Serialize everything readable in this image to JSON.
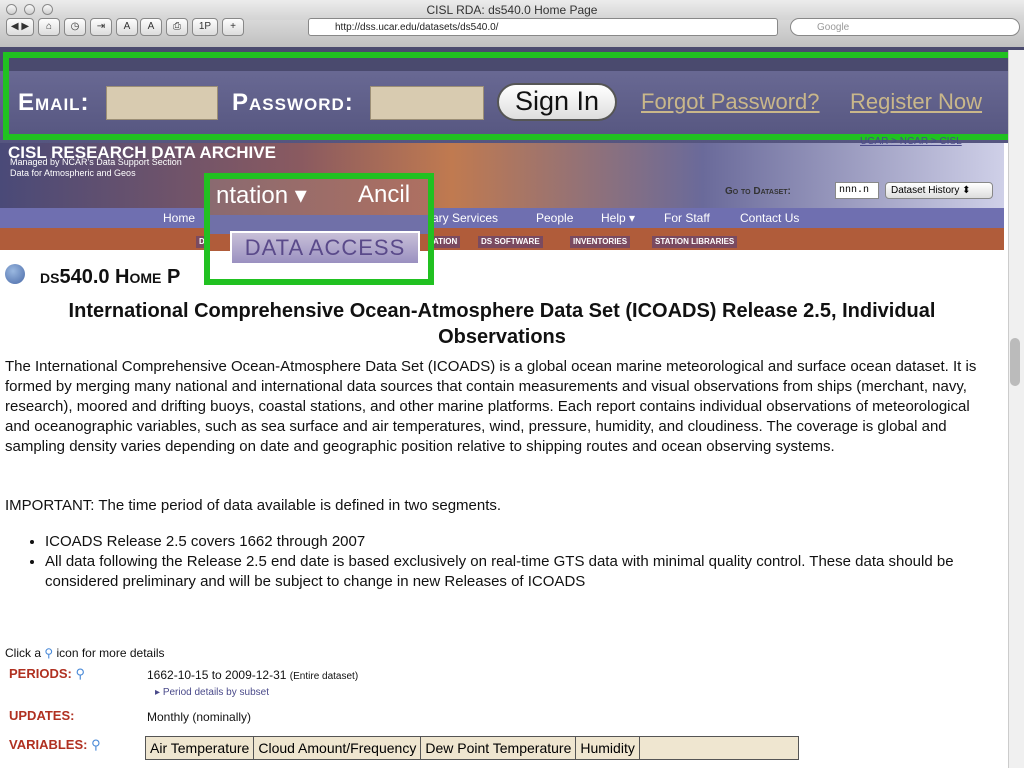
{
  "window": {
    "title": "CISL RDA: ds540.0 Home Page"
  },
  "toolbar": {
    "url": "http://dss.ucar.edu/datasets/ds540.0/",
    "search_placeholder": "Google",
    "buttons": [
      "A",
      "A",
      "1P",
      "+"
    ]
  },
  "login": {
    "email_label": "Email:",
    "password_label": "Password:",
    "sign_in": "Sign In",
    "forgot": "Forgot Password?",
    "register": "Register Now"
  },
  "banner": {
    "title": "CISL RESEARCH DATA ARCHIVE",
    "sub1": "Managed by NCAR's Data Support Section",
    "sub2": "Data for Atmospheric and Geos",
    "breadcrumb": "UCAR > NCAR > CISL",
    "goto_label": "Go to Dataset:",
    "goto_value": "nnn.n",
    "goto_select": "Dataset History"
  },
  "nav": {
    "items": [
      "Home",
      "ary Services",
      "People",
      "Help",
      "For Staff",
      "Contact Us"
    ]
  },
  "subnav": {
    "items": [
      "D",
      "ATION",
      "DS SOFTWARE",
      "INVENTORIES",
      "STATION LIBRARIES"
    ]
  },
  "zoom": {
    "t1": "ntation",
    "t2": "Ancil",
    "tab": "DATA ACCESS"
  },
  "page": {
    "title": "ds540.0 Home P",
    "heading": "International Comprehensive Ocean-Atmosphere Data Set (ICOADS) Release 2.5, Individual Observations",
    "description": "The International Comprehensive Ocean-Atmosphere Data Set (ICOADS) is a global ocean marine meteorological and surface ocean dataset. It is formed by merging many national and international data sources that contain measurements and visual observations from ships (merchant, navy, research), moored and drifting buoys, coastal stations, and other marine platforms. Each report contains individual observations of meteorological and oceanographic variables, such as sea surface and air temperatures, wind, pressure, humidity, and cloudiness. The coverage is global and sampling density varies depending on date and geographic position relative to shipping routes and ocean observing systems.",
    "important": "IMPORTANT: The time period of data available is defined in two segments.",
    "bullets": [
      "ICOADS Release 2.5 covers 1662 through 2007",
      "All data following the Release 2.5 end date is based exclusively on real-time GTS data with minimal quality control. These data should be considered preliminary and will be subject to change in new Releases of ICOADS"
    ],
    "click_hint_pre": "Click a",
    "click_hint_post": "icon for more details",
    "periods_label": "PERIODS:",
    "periods_value": "1662-10-15 to 2009-12-31",
    "periods_note": "(Entire dataset)",
    "periods_link": "Period details by subset",
    "updates_label": "UPDATES:",
    "updates_value": "Monthly (nominally)",
    "variables_label": "VARIABLES:",
    "variables": [
      "Air Temperature",
      "Cloud Amount/Frequency",
      "Dew Point Temperature",
      "Humidity",
      ""
    ]
  }
}
